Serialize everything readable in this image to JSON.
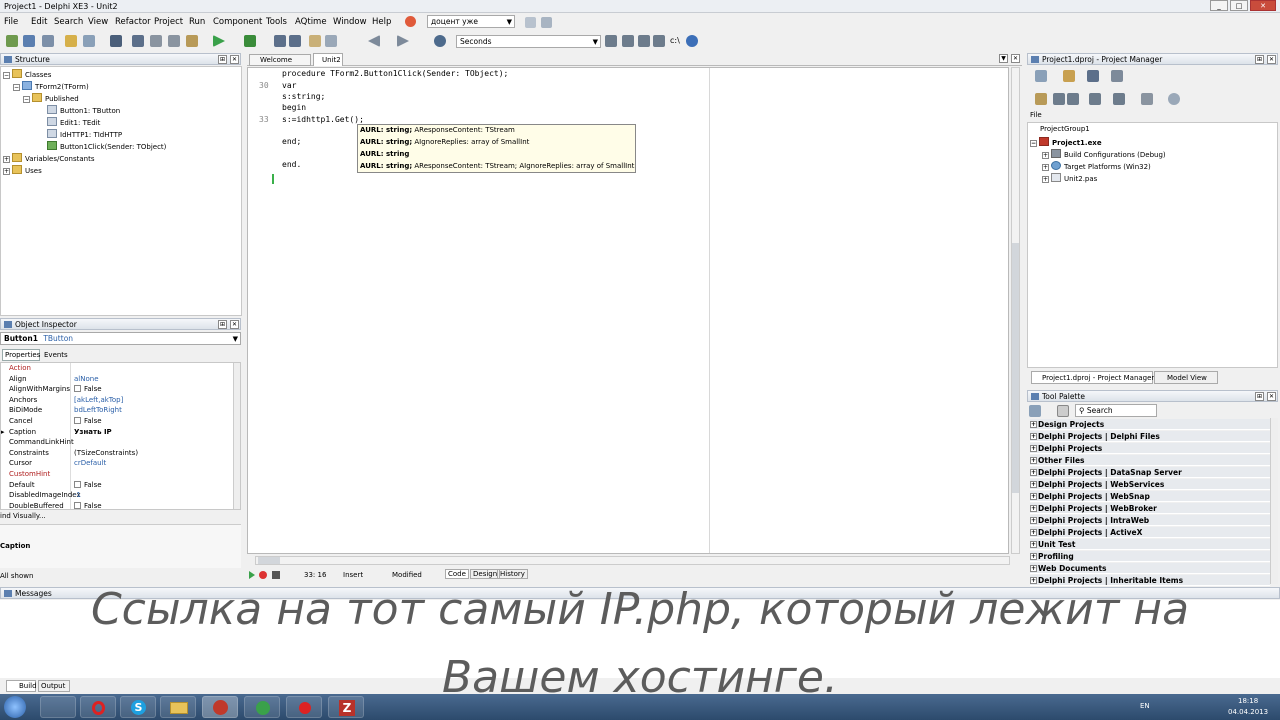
{
  "window": {
    "title": "Project1 - Delphi XE3 - Unit2"
  },
  "menu": {
    "items": [
      "File",
      "Edit",
      "Search",
      "View",
      "Refactor",
      "Project",
      "Run",
      "Component",
      "Tools",
      "AQtime",
      "Window",
      "Help"
    ],
    "search_combo": "доцент уже"
  },
  "toolbar": {
    "desktop_combo": "Seconds",
    "path_label": "c:\\"
  },
  "structure": {
    "title": "Structure",
    "nodes": [
      "Classes",
      "TForm2(TForm)",
      "Published",
      "Button1: TButton",
      "Edit1: TEdit",
      "IdHTTP1: TIdHTTP",
      "Button1Click(Sender: TObject)",
      "Variables/Constants",
      "Uses"
    ]
  },
  "tabs": [
    "Welcome Page",
    "Unit2"
  ],
  "editor": {
    "line_numbers": [
      "30",
      "33"
    ],
    "lines": [
      "procedure TForm2.Button1Click(Sender: TObject);",
      "var",
      "s:string;",
      "begin",
      "s:=idhttp1.Get();",
      "end;",
      "end."
    ],
    "popup": [
      {
        "bold": "AURL: string;",
        "rest": " AResponseContent: TStream"
      },
      {
        "bold": "AURL: string;",
        "rest": " AIgnoreReplies: array of SmallInt"
      },
      {
        "bold": "AURL: string",
        "rest": ""
      },
      {
        "bold": "AURL: string;",
        "rest": " AResponseContent: TStream; AIgnoreReplies: array of SmallInt"
      }
    ]
  },
  "object_inspector": {
    "title": "Object Inspector",
    "selected": "Button1",
    "selected_type": "TButton",
    "tabs": [
      "Properties",
      "Events"
    ],
    "rows": [
      {
        "name": "Action",
        "value": "",
        "red": true
      },
      {
        "name": "Align",
        "value": "alNone",
        "blue": true
      },
      {
        "name": "AlignWithMargins",
        "value": "False",
        "check": true
      },
      {
        "name": "Anchors",
        "value": "[akLeft,akTop]",
        "blue": true
      },
      {
        "name": "BiDiMode",
        "value": "bdLeftToRight",
        "blue": true
      },
      {
        "name": "Cancel",
        "value": "False",
        "check": true
      },
      {
        "name": "Caption",
        "value": "Узнать IP",
        "bold": true
      },
      {
        "name": "CommandLinkHint",
        "value": ""
      },
      {
        "name": "Constraints",
        "value": "(TSizeConstraints)"
      },
      {
        "name": "Cursor",
        "value": "crDefault",
        "blue": true
      },
      {
        "name": "CustomHint",
        "value": "",
        "red": true
      },
      {
        "name": "Default",
        "value": "False",
        "check": true
      },
      {
        "name": "DisabledImageIndex",
        "value": "-1",
        "blue": true
      },
      {
        "name": "DoubleBuffered",
        "value": "False",
        "check": true
      }
    ],
    "bind_visually": "ind Visually...",
    "desc_label": "Caption",
    "show_label": "All shown"
  },
  "statusbar": {
    "pos": "33: 16",
    "mode": "Insert",
    "state": "Modified",
    "tabs": [
      "Code",
      "Design",
      "History"
    ]
  },
  "project_manager": {
    "title": "Project1.dproj - Project Manager",
    "file_label": "File",
    "items": [
      "ProjectGroup1",
      "Project1.exe",
      "Build Configurations (Debug)",
      "Target Platforms (Win32)",
      "Unit2.pas"
    ],
    "bottom_tabs": [
      "Project1.dproj - Project Manager",
      "Model View"
    ]
  },
  "tool_palette": {
    "title": "Tool Palette",
    "search_placeholder": "Search",
    "categories": [
      "Design Projects",
      "Delphi Projects | Delphi Files",
      "Delphi Projects",
      "Other Files",
      "Delphi Projects | DataSnap Server",
      "Delphi Projects | WebServices",
      "Delphi Projects | WebSnap",
      "Delphi Projects | WebBroker",
      "Delphi Projects | IntraWeb",
      "Delphi Projects | ActiveX",
      "Unit Test",
      "Profiling",
      "Web Documents",
      "Delphi Projects | Inheritable Items"
    ]
  },
  "messages": {
    "title": "Messages",
    "tabs": [
      "Build",
      "Output"
    ]
  },
  "subtitle": {
    "line1": "Ссылка на тот самый IP.php, который лежит на",
    "line2": "Вашем хостинге."
  },
  "taskbar": {
    "lang": "EN",
    "time": "18:18",
    "date": "04.04.2013"
  },
  "colors": {
    "accent_blue": "#2a5fa8",
    "popup_bg": "#fffde8",
    "taskbar": "#2c4a6c"
  }
}
